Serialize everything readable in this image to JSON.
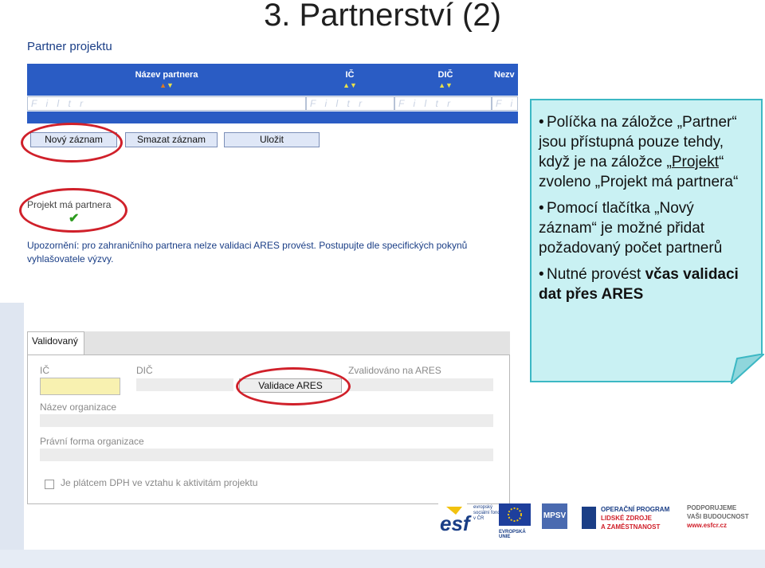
{
  "slide": {
    "title": "3. Partnerství (2)"
  },
  "section": {
    "title": "Partner projektu"
  },
  "grid": {
    "columns": [
      "Název partnera",
      "IČ",
      "DIČ",
      "Nezv"
    ],
    "filter_placeholder": "F i l t r"
  },
  "buttons": {
    "new_record": "Nový záznam",
    "delete_record": "Smazat záznam",
    "save": "Uložit"
  },
  "checkbox": {
    "label": "Projekt má partnera",
    "checked": true
  },
  "warning": "Upozornění: pro zahraničního partnera nelze validaci ARES provést. Postupujte dle specifických pokynů vyhlašovatele výzvy.",
  "tab": {
    "label": "Validovaný"
  },
  "form": {
    "ic_label": "IČ",
    "dic_label": "DIČ",
    "validated_label": "Zvalidováno na ARES",
    "ares_button": "Validace ARES",
    "org_name_label": "Název organizace",
    "legal_form_label": "Právní forma organizace",
    "vat_label": "Je plátcem DPH ve vztahu k aktivitám projektu"
  },
  "callout": {
    "b1_pre": "Políčka na záložce „Partner“ jsou přístupná pouze tehdy, když je na záložce „",
    "b1_link": "Projekt",
    "b1_post": "“ zvoleno „Projekt má partnera“",
    "b2": "Pomocí tlačítka „Nový záznam“ je možné přidat požadovaný počet partnerů",
    "b3_pre": "Nutné provést ",
    "b3_bold": "včas validaci dat přes ARES"
  },
  "logos": {
    "esf_small": "evropský sociální fond v ČR",
    "eu_label": "EVROPSKÁ UNIE",
    "mpsv": "MPSV",
    "op_line1": "OPERAČNÍ PROGRAM",
    "op_line2": "LIDSKÉ ZDROJE",
    "op_line3": "A ZAMĚSTNANOST",
    "support_line1": "PODPORUJEME",
    "support_line2": "VAŠI BUDOUCNOST",
    "support_url": "www.esfcr.cz"
  },
  "colors": {
    "grid_blue": "#2a5cc4",
    "highlight_red": "#d0202a",
    "callout_bg": "#c9f1f3",
    "callout_border": "#3cb8c4"
  }
}
